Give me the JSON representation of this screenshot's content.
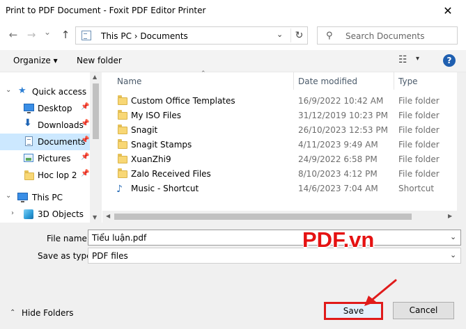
{
  "window": {
    "title": "Print to PDF Document - Foxit PDF Editor Printer",
    "close_glyph": "✕"
  },
  "nav": {
    "back_glyph": "←",
    "forward_glyph": "→",
    "recent_glyph": "⌄",
    "up_glyph": "↑",
    "address": "This PC  ›  Documents",
    "refresh_glyph": "↻",
    "search_placeholder": "Search Documents"
  },
  "toolbar": {
    "organize_label": "Organize ▾",
    "new_folder_label": "New folder",
    "view_glyph": "☷",
    "dropdown_glyph": "▾",
    "help_label": "?"
  },
  "sidebar": {
    "quick_access": "Quick access",
    "items": [
      {
        "label": "Desktop",
        "icon": "desktop-icon",
        "pinned": true
      },
      {
        "label": "Downloads",
        "icon": "downloads-icon",
        "pinned": true
      },
      {
        "label": "Documents",
        "icon": "documents-icon",
        "pinned": true,
        "selected": true
      },
      {
        "label": "Pictures",
        "icon": "pictures-icon",
        "pinned": true
      },
      {
        "label": "Hoc lop 2",
        "icon": "folder-icon",
        "pinned": true
      }
    ],
    "this_pc": "This PC",
    "objects_3d": "3D Objects",
    "pin_glyph": "📌",
    "expanded_glyph": "⌄",
    "collapsed_glyph": "›"
  },
  "columns": {
    "name": "Name",
    "date": "Date modified",
    "type": "Type",
    "sort_glyph": "⌃"
  },
  "files": [
    {
      "name": "Custom Office Templates",
      "date": "16/9/2022 10:42 AM",
      "type": "File folder",
      "icon": "folder-icon"
    },
    {
      "name": "My ISO Files",
      "date": "31/12/2019 10:23 PM",
      "type": "File folder",
      "icon": "folder-icon"
    },
    {
      "name": "Snagit",
      "date": "26/10/2023 12:53 PM",
      "type": "File folder",
      "icon": "folder-icon"
    },
    {
      "name": "Snagit Stamps",
      "date": "4/11/2023 9:49 AM",
      "type": "File folder",
      "icon": "folder-icon"
    },
    {
      "name": "XuanZhi9",
      "date": "24/9/2022 6:58 PM",
      "type": "File folder",
      "icon": "folder-icon"
    },
    {
      "name": "Zalo Received Files",
      "date": "8/10/2023 4:12 PM",
      "type": "File folder",
      "icon": "folder-icon"
    },
    {
      "name": "Music - Shortcut",
      "date": "14/6/2023 7:04 AM",
      "type": "Shortcut",
      "icon": "shortcut-icon"
    }
  ],
  "form": {
    "file_name_label": "File name:",
    "file_name_value": "Tiểu luận.pdf",
    "save_as_type_label": "Save as type:",
    "save_as_type_value": "PDF files",
    "dropdown_glyph": "⌄"
  },
  "footer": {
    "hide_folders": "Hide Folders",
    "hide_glyph": "⌃",
    "save_label": "Save",
    "cancel_label": "Cancel"
  },
  "watermark": "PDF.vn",
  "colors": {
    "accent_red": "#e51212",
    "selection": "#cce8ff",
    "folder_yellow": "#f8d775"
  }
}
